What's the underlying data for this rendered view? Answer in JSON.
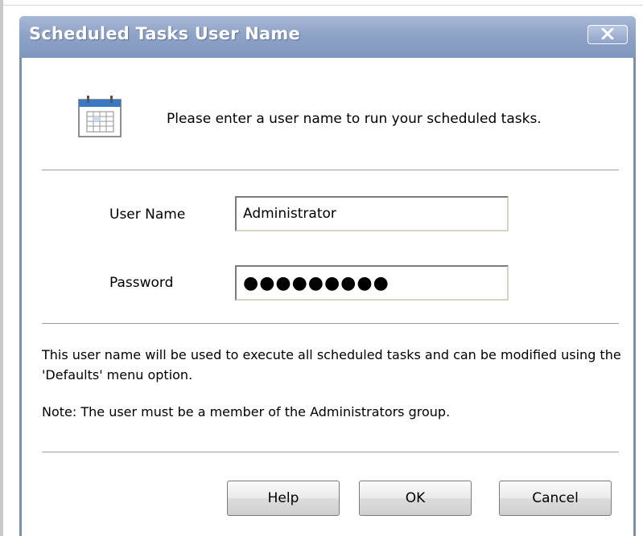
{
  "window": {
    "title": "Scheduled Tasks User Name",
    "close_glyph": "✕"
  },
  "header": {
    "icon": "calendar-icon",
    "message": "Please enter a user name to run your scheduled tasks."
  },
  "form": {
    "username_label": "User Name",
    "username_value": "Administrator",
    "password_label": "Password",
    "password_value": "●●●●●●●●●"
  },
  "info": {
    "line1": "This user name will be used to execute all scheduled tasks and can be modified using the 'Defaults' menu option.",
    "line2": "Note: The user must be a member of the Administrators group."
  },
  "buttons": {
    "help": "Help",
    "ok": "OK",
    "cancel": "Cancel"
  },
  "colors": {
    "titlebar": "#8ea3c7",
    "window_frame": "#7a8fb6",
    "icon_accent": "#3a78c6"
  }
}
